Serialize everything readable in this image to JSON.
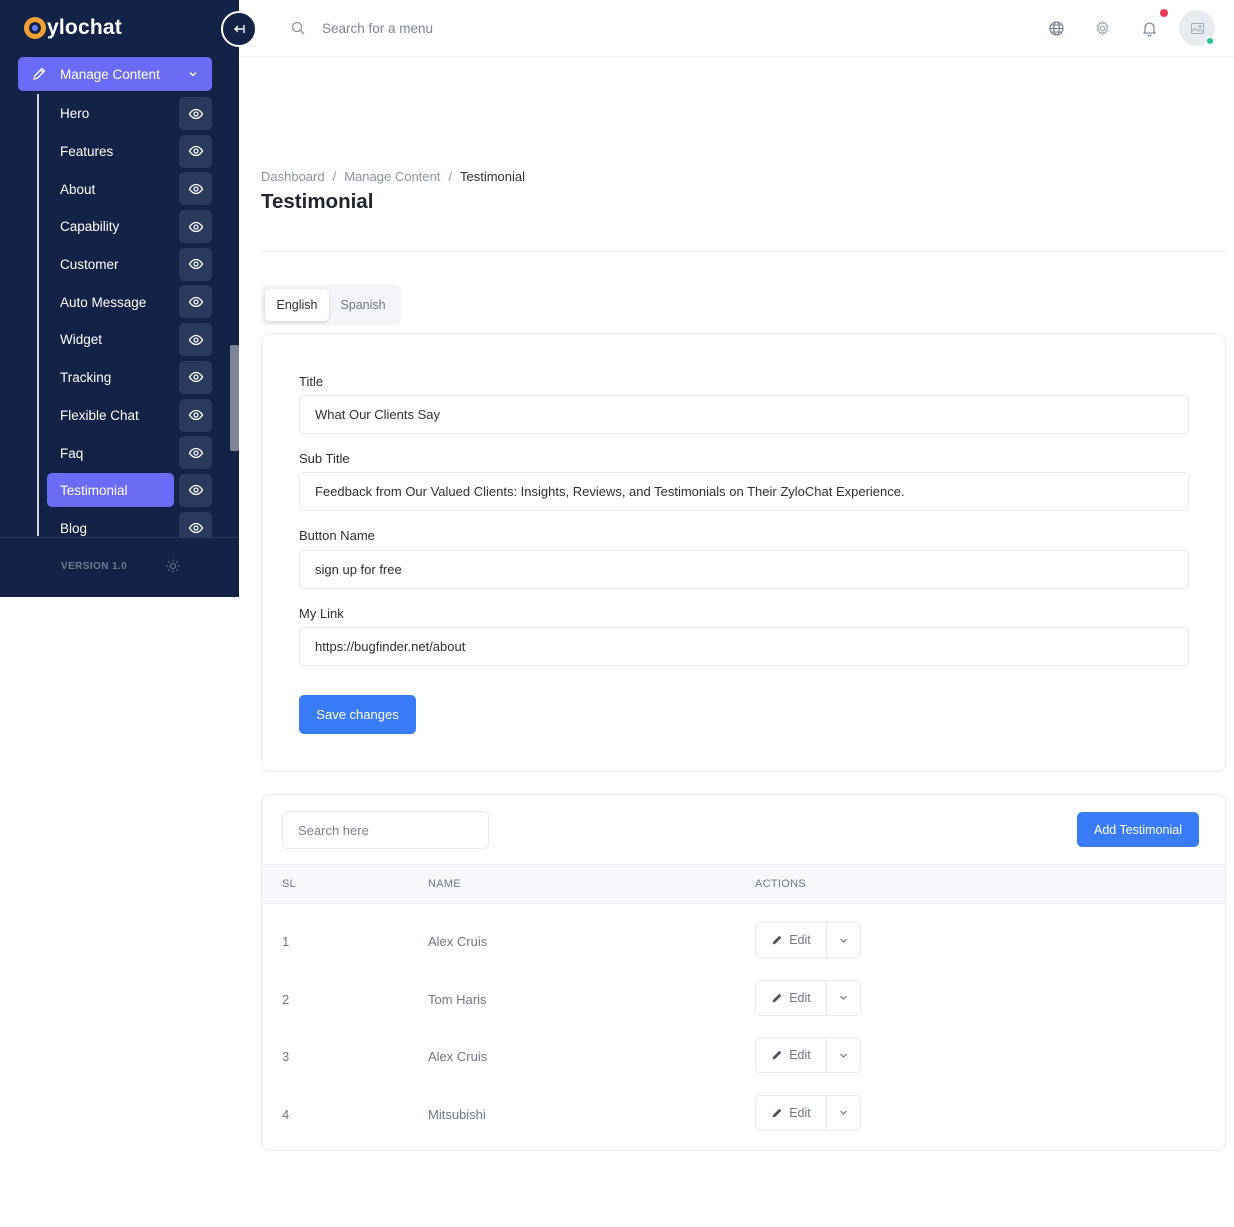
{
  "sidebar": {
    "logo_text": "ylochat",
    "manage_label": "Manage Content",
    "items": [
      {
        "label": "Hero"
      },
      {
        "label": "Features"
      },
      {
        "label": "About"
      },
      {
        "label": "Capability"
      },
      {
        "label": "Customer"
      },
      {
        "label": "Auto Message"
      },
      {
        "label": "Widget"
      },
      {
        "label": "Tracking"
      },
      {
        "label": "Flexible Chat"
      },
      {
        "label": "Faq"
      },
      {
        "label": "Testimonial",
        "active": true
      },
      {
        "label": "Blog"
      }
    ],
    "version": "VERSION 1.0"
  },
  "topbar": {
    "search_placeholder": "Search for a menu"
  },
  "breadcrumb": {
    "items": [
      "Dashboard",
      "Manage Content"
    ],
    "current": "Testimonial"
  },
  "page": {
    "title": "Testimonial"
  },
  "tabs": {
    "active": "English",
    "inactive": "Spanish"
  },
  "form": {
    "title_label": "Title",
    "title_value": "What Our Clients Say",
    "subtitle_label": "Sub Title",
    "subtitle_value": "Feedback from Our Valued Clients: Insights, Reviews, and Testimonials on Their ZyloChat Experience.",
    "button_label": "Button Name",
    "button_value": "sign up for free",
    "link_label": "My Link",
    "link_value": "https://bugfinder.net/about",
    "save_label": "Save changes"
  },
  "table": {
    "search_placeholder": "Search here",
    "add_label": "Add Testimonial",
    "headers": [
      "SL",
      "NAME",
      "ACTIONS"
    ],
    "edit_label": "Edit",
    "rows": [
      {
        "sl": "1",
        "name": "Alex Cruis"
      },
      {
        "sl": "2",
        "name": "Tom Haris"
      },
      {
        "sl": "3",
        "name": "Alex Cruis"
      },
      {
        "sl": "4",
        "name": "Mitsubishi"
      }
    ]
  },
  "colors": {
    "sidebar_bg": "#132347",
    "accent": "#6b6cf6",
    "primary_button": "#3a7bf6"
  }
}
